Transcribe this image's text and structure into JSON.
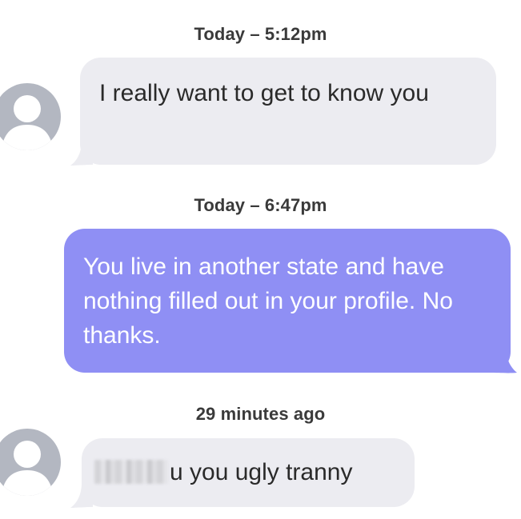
{
  "messages": [
    {
      "timestamp": "Today – 5:12pm",
      "direction": "incoming",
      "text": "I really want to get to know you"
    },
    {
      "timestamp": "Today – 6:47pm",
      "direction": "outgoing",
      "text": "You live in another state and have nothing filled out in your profile. No thanks."
    },
    {
      "timestamp": "29 minutes ago",
      "direction": "incoming",
      "redacted_prefix": true,
      "text": "u you ugly tranny"
    }
  ],
  "colors": {
    "incoming_bubble": "#ececf1",
    "outgoing_bubble": "#8f8ff4",
    "avatar": "#b3b7c1",
    "timestamp_text": "#3a3a3a"
  },
  "icons": {
    "avatar": "person-silhouette-icon"
  }
}
